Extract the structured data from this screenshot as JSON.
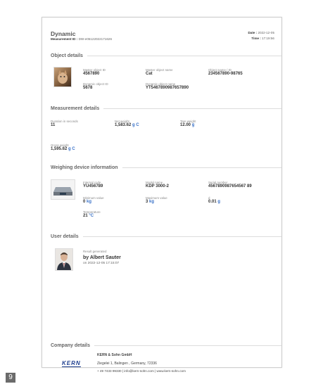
{
  "header": {
    "title": "Dynamic",
    "measurement_id_label": "Measurement ID :",
    "measurement_id": "DW-e05122022171626",
    "date_label": "Date :",
    "date": "2022-12-05",
    "time_label": "Time :",
    "time": "17:19:56"
  },
  "object_details": {
    "heading": "Object details",
    "master_id_label": "Master object ID",
    "master_id": "4567890",
    "master_name_label": "Master object name",
    "master_name": "Cat",
    "object_name_label": "Object name / ID",
    "object_name": "234567890-98765",
    "dynamic_id_label": "Dynamic object ID",
    "dynamic_id": "5678",
    "dynamic_name_label": "Dynamic object name",
    "dynamic_name": "YT5467890987657890",
    "image_icon": "cat-photo-icon"
  },
  "measurement_details": {
    "heading": "Measurement details",
    "duration_label": "Duration in seconds",
    "duration": "11",
    "net_label": "Net weight",
    "net_value": "1,583.62",
    "net_unit": "g C",
    "tare_label": "Tare weight",
    "tare_value": "12.00",
    "tare_unit": "g",
    "gross_label": "Gross weight",
    "gross_value": "1,595.62",
    "gross_unit": "g C"
  },
  "device": {
    "heading": "Weighing device information",
    "internal_label": "Internal code",
    "internal_code": "YU456789",
    "model_label": "Model name",
    "model": "KDP 3000-2",
    "serial_label": "Serial number",
    "serial": "4567890987654567 89",
    "min_label": "Minimum value",
    "min_value": "0",
    "min_unit": "kg",
    "max_label": "Maximum value",
    "max_value": "3",
    "max_unit": "kg",
    "d_label": "d",
    "d_value": "0.01",
    "d_unit": "g",
    "temp_label": "Temperature",
    "temp_value": "21",
    "temp_unit": "°C",
    "image_icon": "scale-device-icon"
  },
  "user": {
    "heading": "User details",
    "result_label": "Result generated",
    "by": "by Albert Sauter",
    "on": "on 2022-12-05 17:15:07",
    "image_icon": "user-portrait-icon"
  },
  "company": {
    "heading": "Company details",
    "logo": "KERN",
    "name": "KERN & Sohn GmbH",
    "address": "Ziegelei 1, Balingen , Germany, 72336",
    "contact": "+ 49 7433 99330 | info@kern-sohn.com | www.kern-sohn.com"
  },
  "page_number": "9"
}
